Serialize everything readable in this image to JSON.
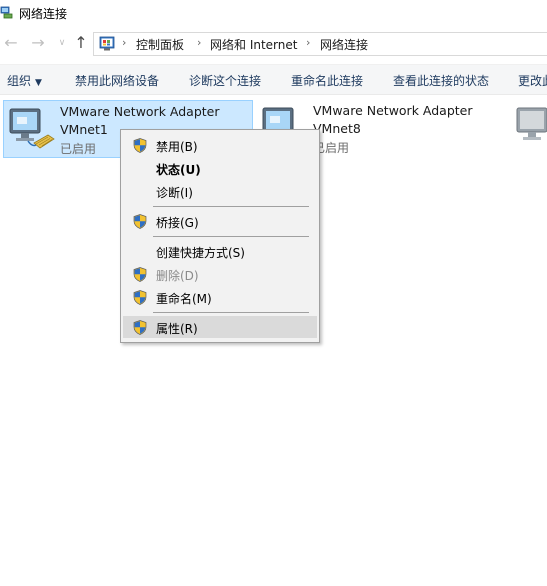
{
  "window": {
    "title": "网络连接"
  },
  "address": {
    "crumbs": [
      "控制面板",
      "网络和 Internet",
      "网络连接"
    ]
  },
  "toolbar": {
    "organize": "组织",
    "disable": "禁用此网络设备",
    "diagnose": "诊断这个连接",
    "rename": "重命名此连接",
    "status": "查看此连接的状态",
    "change": "更改此"
  },
  "adapters": [
    {
      "name": "VMware Network Adapter",
      "sub": "VMnet1",
      "status": "已启用",
      "selected": true
    },
    {
      "name": "VMware Network Adapter",
      "sub": "VMnet8",
      "status": "已启用",
      "selected": false
    }
  ],
  "context_menu": {
    "items": [
      {
        "label": "禁用(B)",
        "icon": "shield-icon"
      },
      {
        "label": "状态(U)",
        "bold": true
      },
      {
        "label": "诊断(I)"
      },
      {
        "label": "桥接(G)",
        "icon": "shield-icon"
      },
      {
        "label": "创建快捷方式(S)"
      },
      {
        "label": "删除(D)",
        "icon": "shield-icon",
        "disabled": true
      },
      {
        "label": "重命名(M)",
        "icon": "shield-icon"
      },
      {
        "label": "属性(R)",
        "icon": "shield-icon",
        "highlighted": true
      }
    ]
  },
  "colors": {
    "selection_bg": "#cce8ff",
    "selection_border": "#99d1ff",
    "toolbar_text": "#1e3a5f",
    "menu_bg": "#f2f2f2",
    "menu_hover": "#dadada"
  }
}
